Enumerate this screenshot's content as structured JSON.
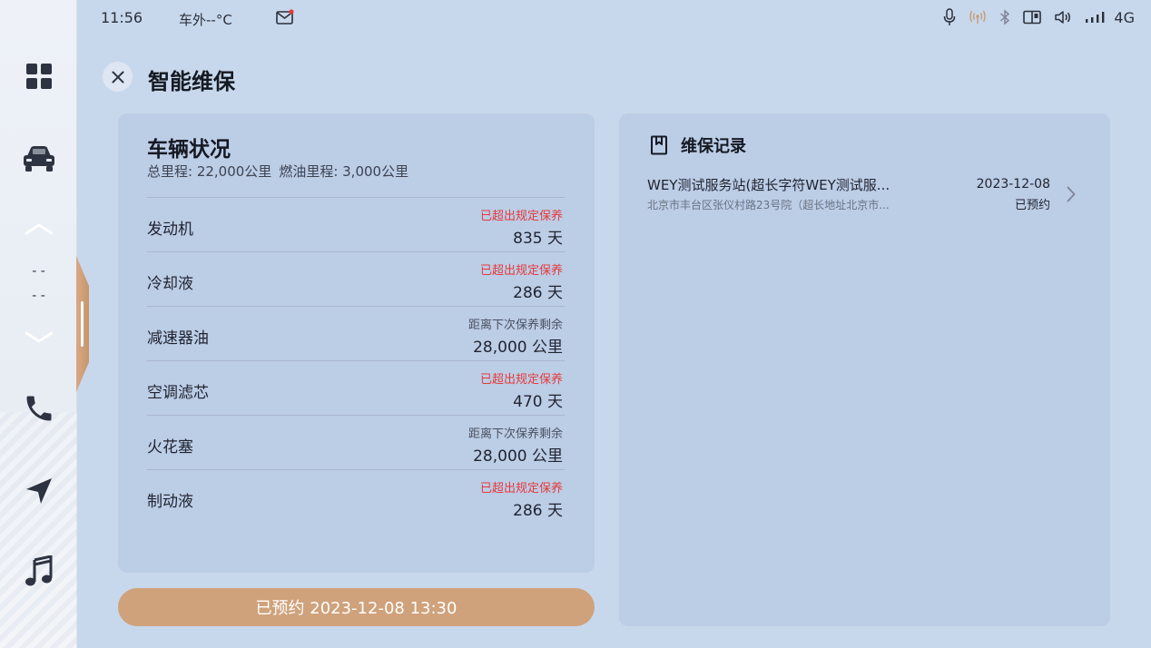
{
  "status_bar": {
    "time": "11:56",
    "outside_temp": "车外--°C",
    "network": "4G",
    "icons": [
      "mail-icon",
      "microphone-icon",
      "hotspot-icon",
      "bluetooth-icon",
      "screen-icon",
      "volume-icon",
      "signal-icon"
    ]
  },
  "dock": {
    "items": [
      "apps-grid-icon",
      "car-icon",
      "chevron-up-icon",
      "chevron-down-icon",
      "phone-icon",
      "navigation-icon",
      "music-icon"
    ],
    "temp_placeholder_top": "- -",
    "temp_placeholder_bottom": "- -"
  },
  "page": {
    "title": "智能维保"
  },
  "vehicle": {
    "title": "车辆状况",
    "total_mileage": "总里程: 22,000公里",
    "fuel_mileage": "燃油里程: 3,000公里",
    "items": [
      {
        "name": "发动机",
        "status": "已超出规定保养",
        "status_type": "over",
        "value": "835 天"
      },
      {
        "name": "冷却液",
        "status": "已超出规定保养",
        "status_type": "over",
        "value": "286 天"
      },
      {
        "name": "减速器油",
        "status": "距离下次保养剩余",
        "status_type": "normal",
        "value": "28,000 公里"
      },
      {
        "name": "空调滤芯",
        "status": "已超出规定保养",
        "status_type": "over",
        "value": "470 天"
      },
      {
        "name": "火花塞",
        "status": "距离下次保养剩余",
        "status_type": "normal",
        "value": "28,000 公里"
      },
      {
        "name": "制动液",
        "status": "已超出规定保养",
        "status_type": "over",
        "value": "286 天"
      }
    ]
  },
  "booking_button": "已预约 2023-12-08 13:30",
  "records": {
    "title": "维保记录",
    "items": [
      {
        "name": "WEY测试服务站(超长字符WEY测试服...",
        "address": "北京市丰台区张仪村路23号院（超长地址北京市...",
        "date": "2023-12-08",
        "state": "已预约"
      }
    ]
  },
  "colors": {
    "background": "#c8d8ec",
    "card": "#bccde6",
    "accent": "#cfa27b",
    "warning": "#e43a3a"
  }
}
